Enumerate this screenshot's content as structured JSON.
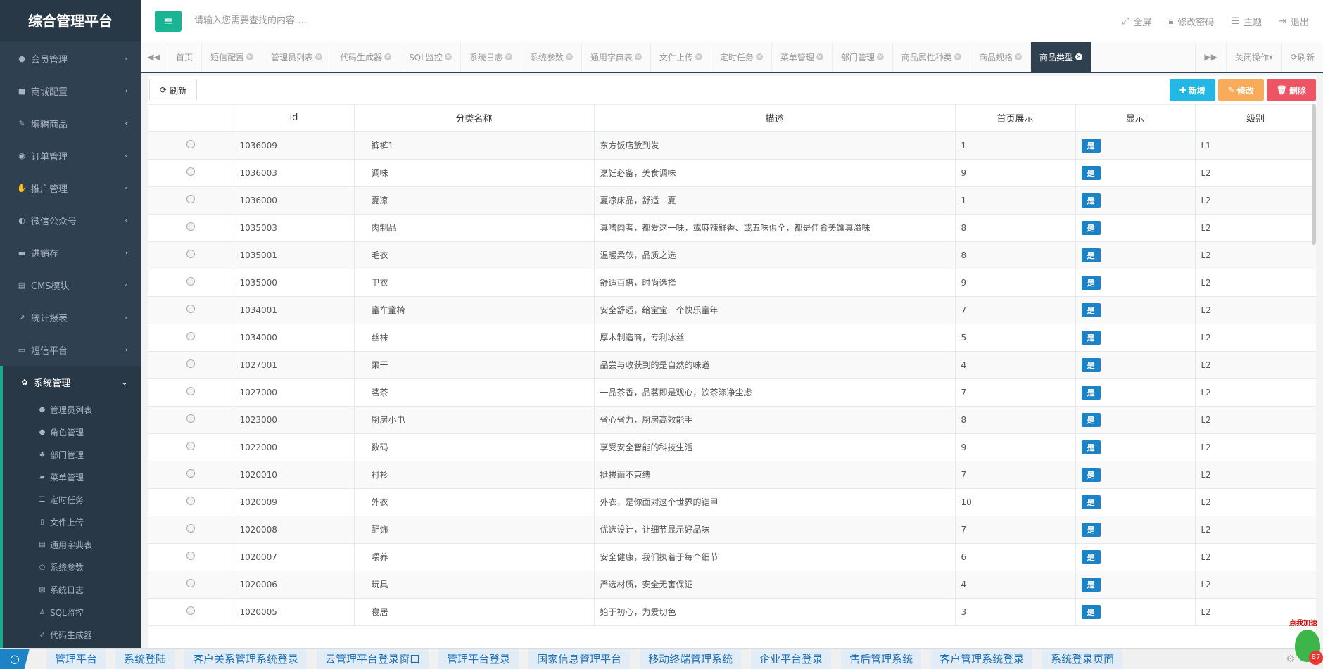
{
  "app_title": "综合管理平台",
  "sidebar": {
    "items": [
      {
        "icon": "user-icon",
        "glyph": "●",
        "label": "会员管理"
      },
      {
        "icon": "cart-icon",
        "glyph": "■",
        "label": "商城配置"
      },
      {
        "icon": "edit-icon",
        "glyph": "✎",
        "label": "编辑商品"
      },
      {
        "icon": "order-icon",
        "glyph": "◉",
        "label": "订单管理"
      },
      {
        "icon": "promote-icon",
        "glyph": "✋",
        "label": "推广管理"
      },
      {
        "icon": "wechat-icon",
        "glyph": "◐",
        "label": "微信公众号"
      },
      {
        "icon": "truck-icon",
        "glyph": "▬",
        "label": "进销存"
      },
      {
        "icon": "book-icon",
        "glyph": "▤",
        "label": "CMS模块"
      },
      {
        "icon": "chart-icon",
        "glyph": "↗",
        "label": "统计报表"
      },
      {
        "icon": "monitor-icon",
        "glyph": "▭",
        "label": "短信平台"
      }
    ],
    "active": {
      "icon": "cog-icon",
      "glyph": "✿",
      "label": "系统管理"
    },
    "sub_items": [
      {
        "icon": "admin-user-icon",
        "glyph": "●",
        "label": "管理员列表"
      },
      {
        "icon": "role-icon",
        "glyph": "●",
        "label": "角色管理"
      },
      {
        "icon": "sitemap-icon",
        "glyph": "♣",
        "label": "部门管理"
      },
      {
        "icon": "folder-icon",
        "glyph": "▰",
        "label": "菜单管理"
      },
      {
        "icon": "task-icon",
        "glyph": "☰",
        "label": "定时任务"
      },
      {
        "icon": "upload-icon",
        "glyph": "▯",
        "label": "文件上传"
      },
      {
        "icon": "dict-icon",
        "glyph": "▤",
        "label": "通用字典表"
      },
      {
        "icon": "circle-icon",
        "glyph": "○",
        "label": "系统参数"
      },
      {
        "icon": "log-icon",
        "glyph": "▧",
        "label": "系统日志"
      },
      {
        "icon": "sql-icon",
        "glyph": "♙",
        "label": "SQL监控"
      },
      {
        "icon": "rocket-icon",
        "glyph": "➶",
        "label": "代码生成器"
      }
    ]
  },
  "topbar": {
    "search_placeholder": "请输入您需要查找的内容 …",
    "fullscreen": "全屏",
    "change_password": "修改密码",
    "theme": "主题",
    "logout": "退出"
  },
  "tabs": [
    {
      "label": "首页",
      "closable": false
    },
    {
      "label": "短信配置",
      "closable": true
    },
    {
      "label": "管理员列表",
      "closable": true
    },
    {
      "label": "代码生成器",
      "closable": true
    },
    {
      "label": "SQL监控",
      "closable": true
    },
    {
      "label": "系统日志",
      "closable": true
    },
    {
      "label": "系统参数",
      "closable": true
    },
    {
      "label": "通用字典表",
      "closable": true
    },
    {
      "label": "文件上传",
      "closable": true
    },
    {
      "label": "定时任务",
      "closable": true
    },
    {
      "label": "菜单管理",
      "closable": true
    },
    {
      "label": "部门管理",
      "closable": true
    },
    {
      "label": "商品属性种类",
      "closable": true
    },
    {
      "label": "商品规格",
      "closable": true
    },
    {
      "label": "商品类型",
      "closable": true,
      "active": true
    }
  ],
  "tab_actions": {
    "close_ops": "关闭操作",
    "refresh": "刷新"
  },
  "toolbar": {
    "refresh": "刷新",
    "add": "新增",
    "edit": "修改",
    "delete": "删除"
  },
  "table": {
    "columns": [
      "",
      "id",
      "分类名称",
      "描述",
      "首页展示",
      "显示",
      "级别"
    ],
    "rows": [
      {
        "id": "1036009",
        "name": "裤裤1",
        "desc": "东方饭店放到发",
        "home": "1",
        "show": "是",
        "level": "L1"
      },
      {
        "id": "1036003",
        "name": "调味",
        "desc": "烹饪必备，美食调味",
        "home": "9",
        "show": "是",
        "level": "L2"
      },
      {
        "id": "1036000",
        "name": "夏凉",
        "desc": "夏凉床品，舒适一夏",
        "home": "1",
        "show": "是",
        "level": "L2"
      },
      {
        "id": "1035003",
        "name": "肉制品",
        "desc": "真嗜肉者，都爱这一味，或麻辣鲜香、或五味俱全，都是佳肴美馔真滋味",
        "home": "8",
        "show": "是",
        "level": "L2"
      },
      {
        "id": "1035001",
        "name": "毛衣",
        "desc": "温暖柔软，品质之选",
        "home": "8",
        "show": "是",
        "level": "L2"
      },
      {
        "id": "1035000",
        "name": "卫衣",
        "desc": "舒适百搭，时尚选择",
        "home": "9",
        "show": "是",
        "level": "L2"
      },
      {
        "id": "1034001",
        "name": "童车童椅",
        "desc": "安全舒适，给宝宝一个快乐童年",
        "home": "7",
        "show": "是",
        "level": "L2"
      },
      {
        "id": "1034000",
        "name": "丝袜",
        "desc": "厚木制造商，专利冰丝",
        "home": "5",
        "show": "是",
        "level": "L2"
      },
      {
        "id": "1027001",
        "name": "果干",
        "desc": "品尝与收获到的是自然的味道",
        "home": "4",
        "show": "是",
        "level": "L2"
      },
      {
        "id": "1027000",
        "name": "茗茶",
        "desc": "一品茶香，品茗即是观心，饮茶涤净尘虑",
        "home": "7",
        "show": "是",
        "level": "L2"
      },
      {
        "id": "1023000",
        "name": "厨房小电",
        "desc": "省心省力，厨房高效能手",
        "home": "8",
        "show": "是",
        "level": "L2"
      },
      {
        "id": "1022000",
        "name": "数码",
        "desc": "享受安全智能的科技生活",
        "home": "9",
        "show": "是",
        "level": "L2"
      },
      {
        "id": "1020010",
        "name": "衬衫",
        "desc": "挺拔而不束缚",
        "home": "7",
        "show": "是",
        "level": "L2"
      },
      {
        "id": "1020009",
        "name": "外衣",
        "desc": "外衣，是你面对这个世界的铠甲",
        "home": "10",
        "show": "是",
        "level": "L2"
      },
      {
        "id": "1020008",
        "name": "配饰",
        "desc": "优选设计，让细节显示好品味",
        "home": "7",
        "show": "是",
        "level": "L2"
      },
      {
        "id": "1020007",
        "name": "喂养",
        "desc": "安全健康，我们执着于每个细节",
        "home": "6",
        "show": "是",
        "level": "L2"
      },
      {
        "id": "1020006",
        "name": "玩具",
        "desc": "严选材质，安全无害保证",
        "home": "4",
        "show": "是",
        "level": "L2"
      },
      {
        "id": "1020005",
        "name": "寝居",
        "desc": "始于初心，为爱切色",
        "home": "3",
        "show": "是",
        "level": "L2"
      }
    ]
  },
  "footer": {
    "links": [
      "管理平台",
      "系统登陆",
      "客户关系管理系统登录",
      "云管理平台登录窗口",
      "管理平台登录",
      "国家信息管理平台",
      "移动终端管理系统",
      "企业平台登录",
      "售后管理系统",
      "客户管理系统登录",
      "系统登录页面"
    ],
    "badge_label": "点我加速",
    "badge_number": "87"
  },
  "colors": {
    "sidebar_bg": "#2f4050",
    "accent_green": "#1ab394",
    "badge_blue": "#1c84c6",
    "add_btn": "#23b7e5",
    "edit_btn": "#f8ac59",
    "delete_btn": "#ed5565"
  }
}
